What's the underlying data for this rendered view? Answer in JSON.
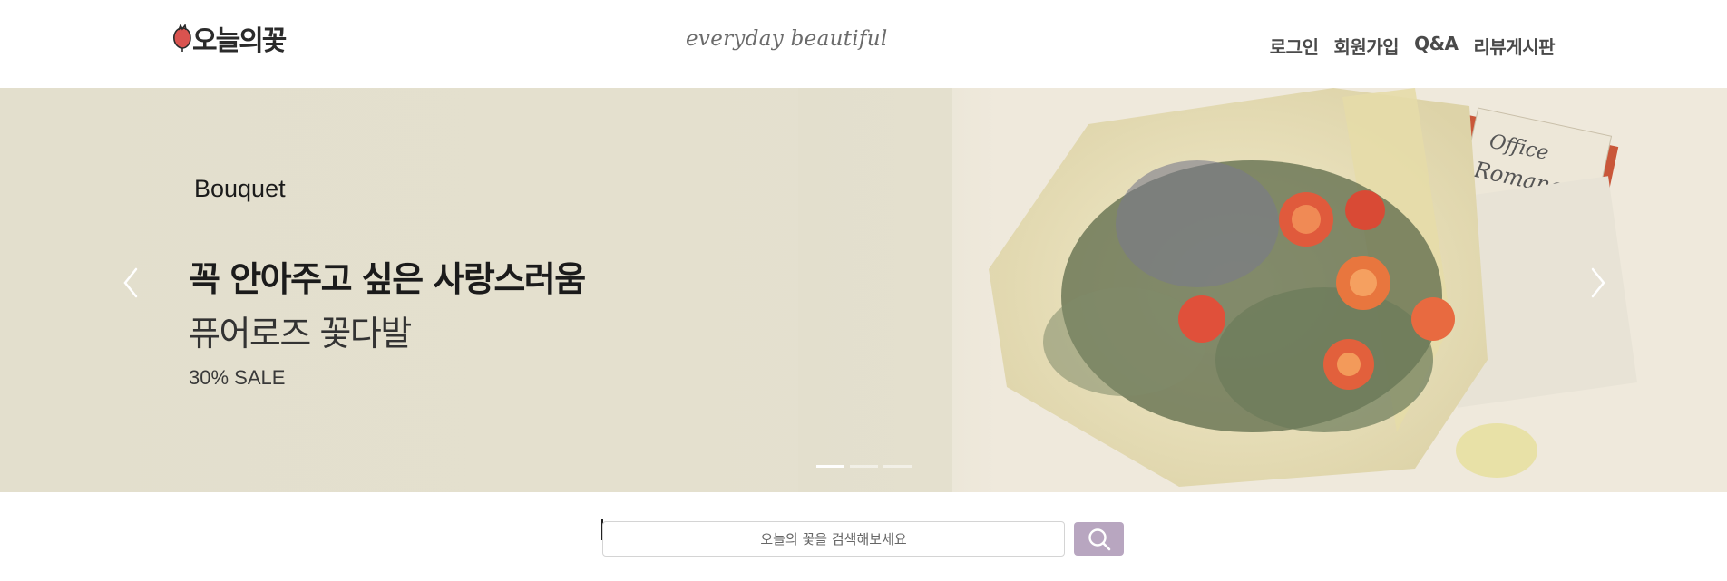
{
  "header": {
    "logo_text": "오늘의꽃",
    "tagline": "everyday beautiful",
    "nav": [
      {
        "label": "로그인"
      },
      {
        "label": "회원가입"
      },
      {
        "label": "Q&A"
      },
      {
        "label": "리뷰게시판"
      }
    ]
  },
  "hero": {
    "category": "Bouquet",
    "headline": "꼭 안아주고 싶은 사랑스러움",
    "subline": "퓨어로즈 꽃다발",
    "sale": "30% SALE",
    "indicators": [
      {
        "active": true
      },
      {
        "active": false
      },
      {
        "active": false
      }
    ]
  },
  "search": {
    "placeholder": "오늘의 꽃을 검색해보세요",
    "value": ""
  },
  "colors": {
    "search_button": "#b8a6c0",
    "hero_background": "#e3dfcd",
    "logo_accent": "#d9534f"
  }
}
